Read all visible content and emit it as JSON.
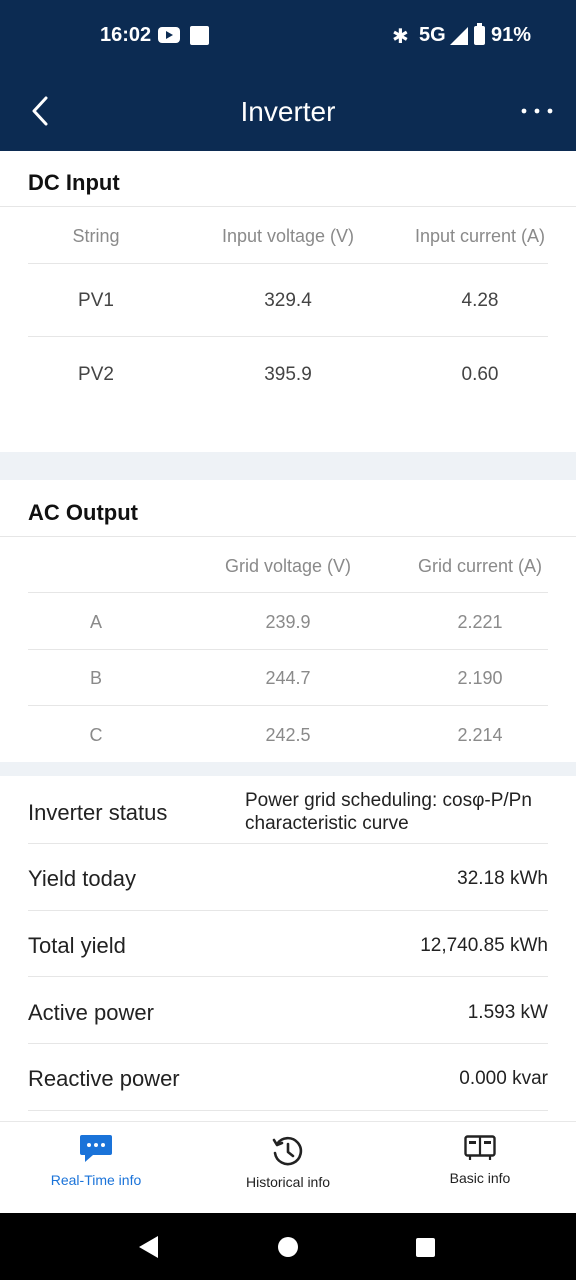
{
  "status_bar": {
    "time": "16:02",
    "network": "5G",
    "battery": "91%",
    "icons": [
      "youtube-icon",
      "square-notification-icon",
      "bluetooth-icon",
      "signal-icon",
      "battery-icon"
    ]
  },
  "app_bar": {
    "title": "Inverter",
    "back_icon": "chevron-left-icon",
    "more_icon": "more-horizontal-icon"
  },
  "dc_input": {
    "title": "DC Input",
    "headers": [
      "String",
      "Input voltage (V)",
      "Input current (A)"
    ],
    "rows": [
      {
        "string": "PV1",
        "voltage": "329.4",
        "current": "4.28"
      },
      {
        "string": "PV2",
        "voltage": "395.9",
        "current": "0.60"
      }
    ]
  },
  "ac_output": {
    "title": "AC Output",
    "headers": [
      "",
      "Grid voltage (V)",
      "Grid current (A)"
    ],
    "rows": [
      {
        "phase": "A",
        "voltage": "239.9",
        "current": "2.221"
      },
      {
        "phase": "B",
        "voltage": "244.7",
        "current": "2.190"
      },
      {
        "phase": "C",
        "voltage": "242.5",
        "current": "2.214"
      }
    ]
  },
  "details": {
    "inverter_status": {
      "label": "Inverter status",
      "value_line1": "Power grid scheduling: cosφ-P/Pn",
      "value_line2": "characteristic curve"
    },
    "yield_today": {
      "label": "Yield today",
      "value": "32.18 kWh"
    },
    "total_yield": {
      "label": "Total yield",
      "value": "12,740.85 kWh"
    },
    "active_power": {
      "label": "Active power",
      "value": "1.593 kW"
    },
    "reactive_power": {
      "label": "Reactive power",
      "value": "0.000 kvar"
    }
  },
  "bottom_nav": {
    "items": [
      {
        "label": "Real-Time info",
        "icon": "chat-bubble-icon",
        "active": true
      },
      {
        "label": "Historical info",
        "icon": "history-clock-icon",
        "active": false
      },
      {
        "label": "Basic info",
        "icon": "device-info-icon",
        "active": false
      }
    ]
  },
  "colors": {
    "header_bg": "#0c2b52",
    "accent": "#1a73d9",
    "divider_band": "#eef2f6"
  }
}
